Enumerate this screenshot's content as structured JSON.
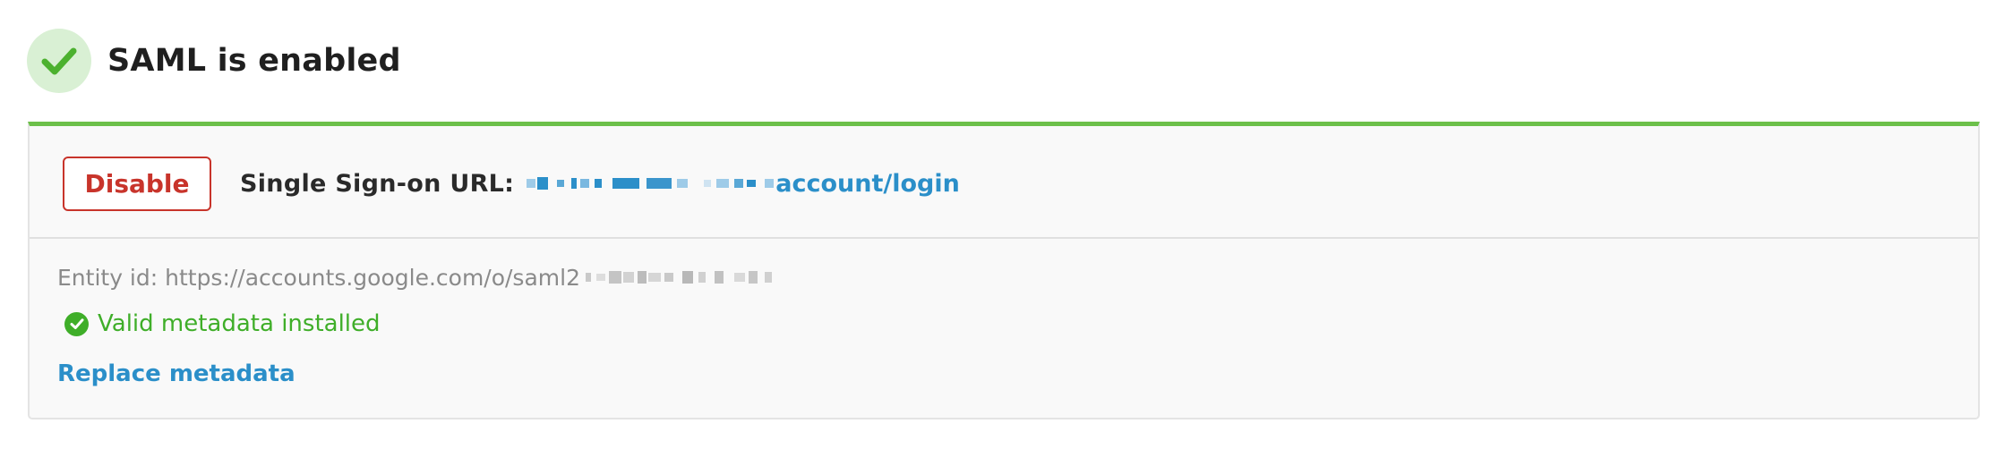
{
  "header": {
    "title": "SAML is enabled",
    "status_icon": "checkmark-icon",
    "status_color": "#4cb12f"
  },
  "sso": {
    "disable_label": "Disable",
    "url_label": "Single Sign-on URL:",
    "url_link_text": "account/login"
  },
  "metadata": {
    "entity_label": "Entity id: https://accounts.google.com/o/saml2",
    "valid_text": "Valid metadata installed",
    "valid_icon": "check-circle-icon",
    "replace_label": "Replace metadata"
  },
  "colors": {
    "accent_green": "#6cc04a",
    "danger_red": "#c8342b",
    "link_blue": "#2b8fc9"
  }
}
